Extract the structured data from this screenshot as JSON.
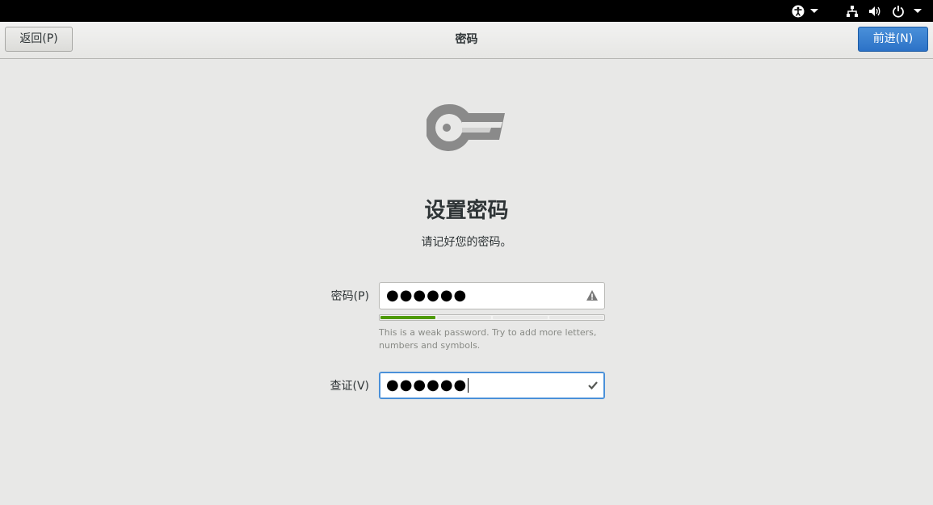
{
  "header": {
    "back_label": "返回(P)",
    "title": "密码",
    "next_label": "前进(N)"
  },
  "system_bar": {
    "icons": [
      "accessibility-icon",
      "network-icon",
      "volume-icon",
      "power-icon"
    ]
  },
  "main": {
    "title": "设置密码",
    "subtitle": "请记好您的密码。",
    "password": {
      "label": "密码(P)",
      "value_masked": "●●●●●●",
      "status_icon": "warning-icon",
      "strength_fraction": 0.25,
      "hint": "This is a weak password. Try to add more letters, numbers and symbols."
    },
    "verify": {
      "label": "查证(V)",
      "value_masked": "●●●●●●",
      "status_icon": "checkmark-icon"
    }
  },
  "colors": {
    "accent": "#4a90d9",
    "strength_weak": "#4e9a06",
    "background": "#e8e8e7"
  }
}
